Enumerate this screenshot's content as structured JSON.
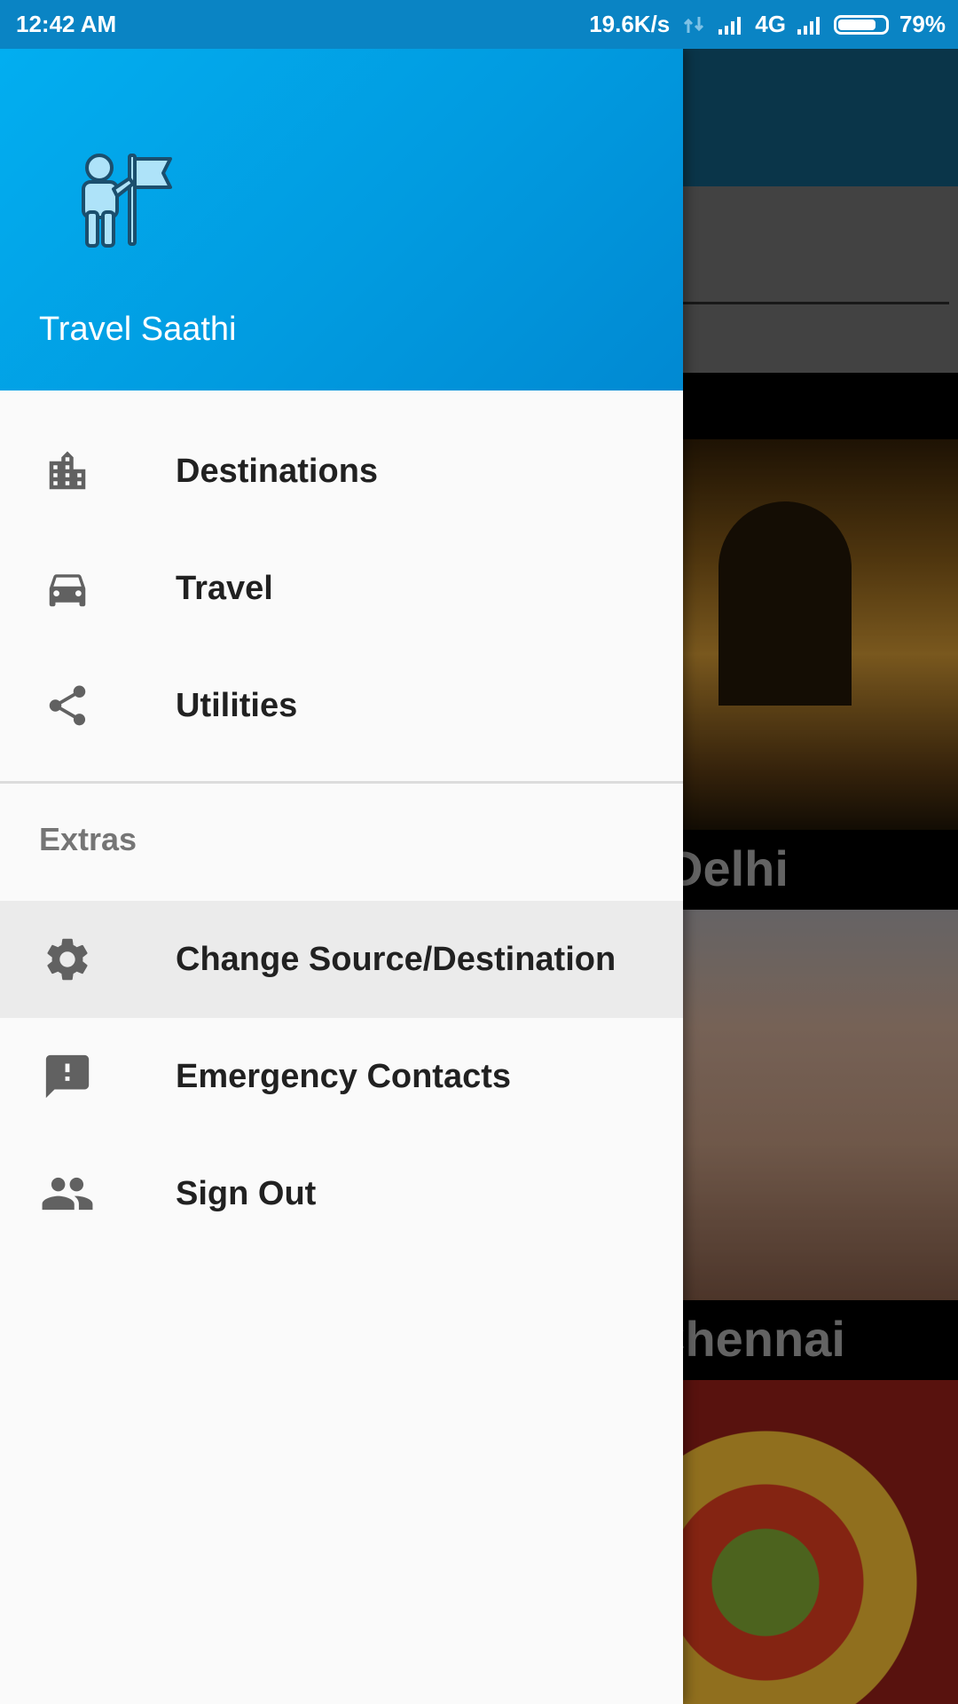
{
  "status_bar": {
    "time": "12:42 AM",
    "net_speed": "19.6K/s",
    "network": "4G",
    "battery": "79%"
  },
  "drawer": {
    "app_name": "Travel Saathi",
    "items": [
      {
        "label": "Destinations",
        "icon": "city-icon"
      },
      {
        "label": "Travel",
        "icon": "car-icon"
      },
      {
        "label": "Utilities",
        "icon": "share-icon"
      }
    ],
    "extras_title": "Extras",
    "extras": [
      {
        "label": "Change Source/Destination",
        "icon": "gear-icon",
        "active": true
      },
      {
        "label": "Emergency Contacts",
        "icon": "alert-message-icon"
      },
      {
        "label": "Sign Out",
        "icon": "people-icon"
      }
    ]
  },
  "background": {
    "captions": [
      "Delhi",
      "Chennai"
    ]
  },
  "colors": {
    "header": "#02aef0",
    "status_bar": "#0a84c4",
    "icon_gray": "#616161"
  }
}
